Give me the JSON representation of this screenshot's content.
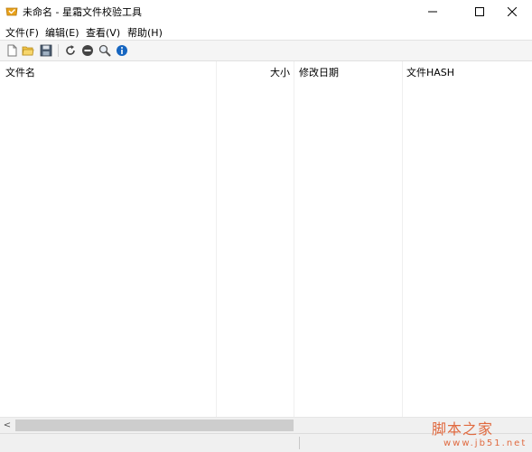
{
  "window": {
    "title": "未命名 - 星霜文件校验工具",
    "icons": [
      "app-icon",
      "minimize-icon",
      "maximize-icon",
      "close-icon"
    ]
  },
  "menu": {
    "items": [
      "文件(F)",
      "编辑(E)",
      "查看(V)",
      "帮助(H)"
    ]
  },
  "toolbar": {
    "icons": [
      "new-file-icon",
      "open-folder-icon",
      "save-icon",
      "refresh-icon",
      "stop-icon",
      "search-icon",
      "info-icon"
    ]
  },
  "list": {
    "columns": [
      "文件名",
      "大小",
      "修改日期",
      "文件HASH"
    ],
    "rows": []
  },
  "scrollbar": {
    "left_arrow": "<"
  },
  "watermark": {
    "text": "脚本之家",
    "url": "www.jb51.net"
  },
  "colors": {
    "app_icon": "#e8a21b",
    "info_icon": "#1565c0",
    "watermark": "#e06a40"
  }
}
